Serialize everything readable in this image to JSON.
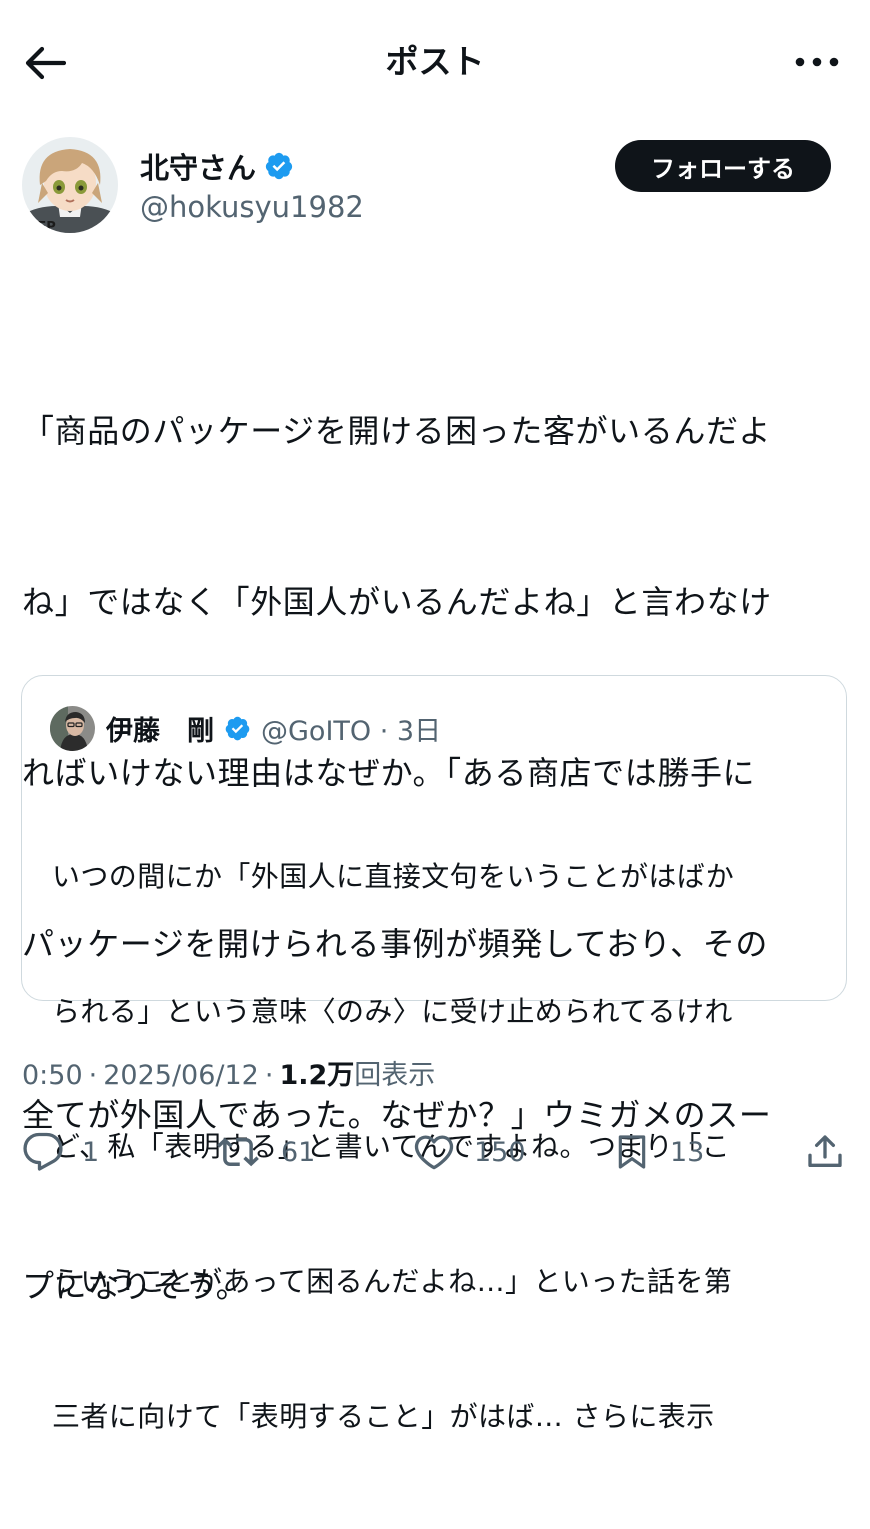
{
  "header": {
    "title": "ポスト"
  },
  "author": {
    "name": "北守さん",
    "handle": "@hokusyu1982",
    "follow_label": "フォローする"
  },
  "post": {
    "lines": [
      "「商品のパッケージを開ける困った客がいるんだよ",
      "ね」ではなく「外国人がいるんだよね」と言わなけ",
      "ればいけない理由はなぜか。「ある商店では勝手に",
      "パッケージを開けられる事例が頻発しており、その",
      "全てが外国人であった。なぜか？」ウミガメのスー",
      "プになりそう。"
    ]
  },
  "quote": {
    "name": "伊藤　剛",
    "handle": "@GoITO",
    "time": "3日",
    "lines": [
      "いつの間にか「外国人に直接文句をいうことがはばか",
      "られる」という意味〈のみ〉に受け止められてるけれ",
      "ど、私「表明する」と書いてんですよね。つまり「こ",
      "ういうことがあって困るんだよね…」といった話を第",
      "三者に向けて「表明すること」がはば…"
    ],
    "show_more": "さらに表示"
  },
  "meta": {
    "time": "0:50",
    "date": "2025/06/12",
    "views": "1.2万",
    "views_label": "回表示"
  },
  "actions": {
    "replies": "1",
    "retweets": "61",
    "likes": "150",
    "bookmarks": "13"
  },
  "colors": {
    "text": "#0f1419",
    "secondary": "#536471",
    "verified": "#1d9bf0",
    "border": "#cfd9de"
  }
}
